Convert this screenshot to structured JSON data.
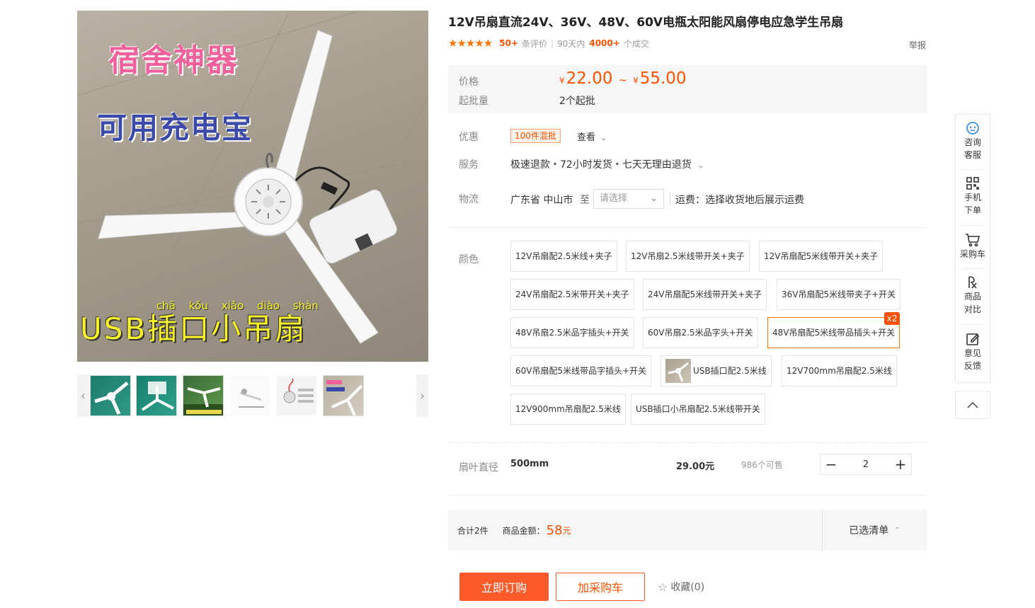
{
  "product": {
    "title": "12V吊扇直流24V、36V、48V、60V电瓶太阳能风扇停电应急学生吊扇",
    "image_overlay": {
      "line1": "宿舍神器",
      "line2": "可用充电宝",
      "line3": "USB插口小吊扇",
      "pinyin": "chā kǒu xiǎo diào shàn"
    },
    "thumbnails": [
      "thumb-1",
      "thumb-2",
      "thumb-3",
      "thumb-4",
      "thumb-5",
      "thumb-6"
    ]
  },
  "rating": {
    "stars": "★★★★★",
    "review_count": "50+",
    "review_label": "条评价",
    "period_label": "90天内",
    "deal_count": "4000+",
    "deal_label": "个成交",
    "report": "举报"
  },
  "price": {
    "label": "价格",
    "currency": "¥",
    "low": "22.00",
    "separator": "~",
    "high": "55.00",
    "min_batch_label": "起批量",
    "min_batch_value": "2个起批"
  },
  "promo": {
    "label": "优惠",
    "tag": "100件混批",
    "view": "查看"
  },
  "service": {
    "label": "服务",
    "text": "极速退款・72小时发货・七天无理由退货"
  },
  "logistics": {
    "label": "物流",
    "from": "广东省 中山市",
    "to_label": "至",
    "select_placeholder": "请选择",
    "fee_text": "运费：选择收货地后展示运费"
  },
  "color": {
    "label": "颜色",
    "options": [
      "12V吊扇配2.5米线+夹子",
      "12V吊扇2.5米线带开关+夹子",
      "12V吊扇配5米线带开关+夹子",
      "24V吊扇配2.5米带开关+夹子",
      "24V吊扇配5米线带开关+夹子",
      "36V吊扇配5米线带夹子+开关",
      "48V吊扇2.5米品字插头+开关",
      "60V吊扇2.5米品字头+开关",
      "48V吊扇配5米线带品插头+开关",
      "60V吊扇配5米线带品字插头+开关",
      "USB插口配2.5米线",
      "12V700mm吊扇配2.5米线",
      "12V900mm吊扇配2.5米线",
      "USB插口小吊扇配2.5米线带开关"
    ],
    "selected_badge": "x2"
  },
  "sku": {
    "label": "扇叶直径",
    "name": "500mm",
    "price": "29.00元",
    "stock": "986个可售",
    "quantity": "2",
    "minus": "−",
    "plus": "+"
  },
  "summary": {
    "total_items": "合计2件",
    "amount_label": "商品金额：",
    "amount": "58",
    "amount_unit": "元",
    "selected_list": "已选清单"
  },
  "actions": {
    "buy": "立即订购",
    "cart": "加采购车",
    "favorite": "收藏(0)"
  },
  "toolbar": {
    "consult": [
      "咨询",
      "客服"
    ],
    "mobile": [
      "手机",
      "下单"
    ],
    "cart": "采购车",
    "compare": [
      "商品",
      "对比"
    ],
    "feedback": [
      "意见",
      "反馈"
    ]
  },
  "colors": {
    "accent": "#ff5000",
    "button": "#ff5a2a",
    "panel_bg": "#f6f6f6",
    "stars": "#ff7300",
    "icon_blue": "#3d8ee8"
  }
}
